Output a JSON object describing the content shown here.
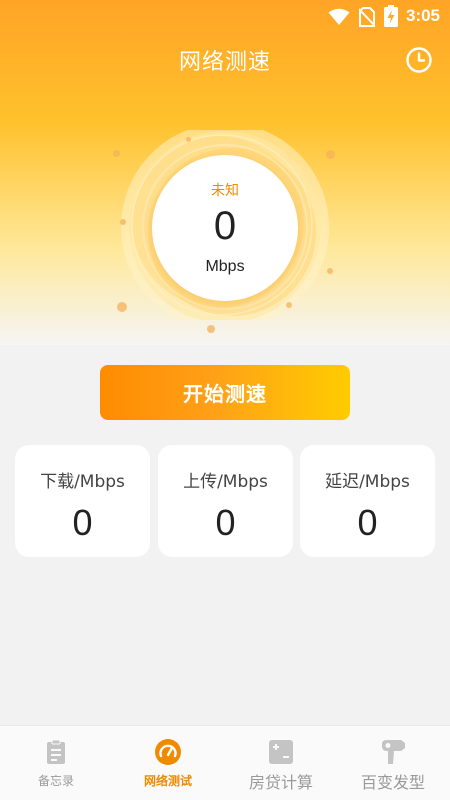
{
  "status": {
    "time": "3:05"
  },
  "header": {
    "title": "网络测速",
    "history_icon": "clock-icon"
  },
  "gauge": {
    "status": "未知",
    "value": "0",
    "unit": "Mbps"
  },
  "start_button": "开始测速",
  "stats": [
    {
      "label": "下载/Mbps",
      "value": "0"
    },
    {
      "label": "上传/Mbps",
      "value": "0"
    },
    {
      "label": "延迟/Mbps",
      "value": "0"
    }
  ],
  "tabs": [
    {
      "label": "备忘录",
      "icon": "memo-icon",
      "active": false
    },
    {
      "label": "网络测试",
      "icon": "speedometer-icon",
      "active": true
    },
    {
      "label": "房贷计算",
      "icon": "calculator-icon",
      "active": false
    },
    {
      "label": "百变发型",
      "icon": "hairdryer-icon",
      "active": false
    }
  ],
  "colors": {
    "accent": "#f08a00",
    "gradient_start": "#ff8c00",
    "gradient_end": "#ffcc00",
    "inactive": "#9a9a9a"
  }
}
